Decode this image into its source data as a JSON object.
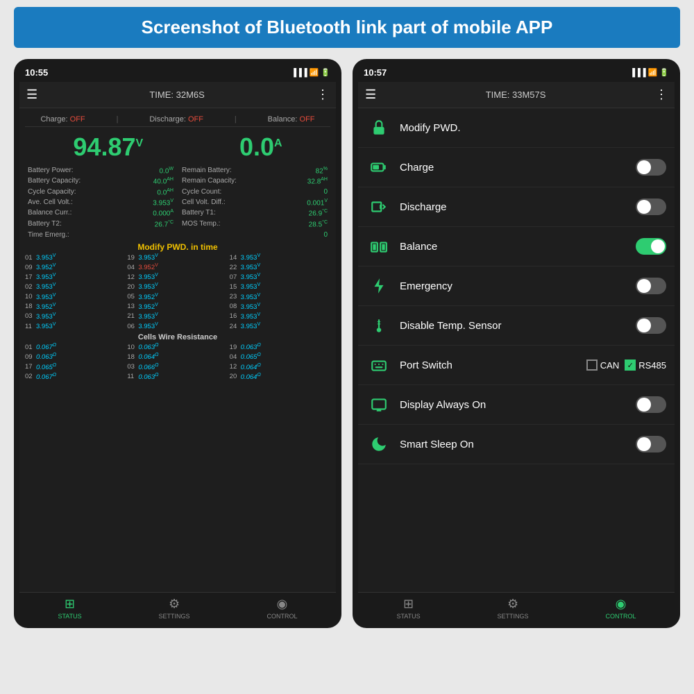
{
  "header": {
    "title": "Screenshot of Bluetooth link part of mobile APP"
  },
  "left_phone": {
    "status_bar": {
      "time": "10:55"
    },
    "app_bar": {
      "time_label": "TIME: 32M6S"
    },
    "charge_row": {
      "charge": "Charge: OFF",
      "discharge": "Discharge: OFF",
      "balance": "Balance: OFF"
    },
    "volt": "94.87",
    "volt_unit": "V",
    "amp": "0.0",
    "amp_unit": "A",
    "stats": [
      {
        "label": "Battery Power:",
        "val": "0.0",
        "unit": "W"
      },
      {
        "label": "Remain Battery:",
        "val": "82",
        "unit": "%"
      },
      {
        "label": "Battery Capacity:",
        "val": "40.0",
        "unit": "AH"
      },
      {
        "label": "Remain Capacity:",
        "val": "32.8",
        "unit": "AH"
      },
      {
        "label": "Cycle Capacity:",
        "val": "0.0",
        "unit": "AH"
      },
      {
        "label": "Cycle Count:",
        "val": "0",
        "unit": ""
      },
      {
        "label": "Ave. Cell Volt.:",
        "val": "3.953",
        "unit": "V"
      },
      {
        "label": "Cell Volt. Diff.:",
        "val": "0.001",
        "unit": "V"
      },
      {
        "label": "Balance Curr.:",
        "val": "0.000",
        "unit": "A"
      },
      {
        "label": "Battery T1:",
        "val": "26.9",
        "unit": "°C"
      },
      {
        "label": "Battery T2:",
        "val": "26.7",
        "unit": "°C"
      },
      {
        "label": "MOS Temp.:",
        "val": "28.5",
        "unit": "°C"
      },
      {
        "label": "Time Emerg.:",
        "val": "0",
        "unit": ""
      }
    ],
    "modify_title": "Modify PWD. in time",
    "cells": [
      {
        "num": "01",
        "val": "3.953",
        "red": false
      },
      {
        "num": "09",
        "val": "3.952",
        "red": false
      },
      {
        "num": "17",
        "val": "3.953",
        "red": false
      },
      {
        "num": "02",
        "val": "3.953",
        "red": false
      },
      {
        "num": "10",
        "val": "3.953",
        "red": false
      },
      {
        "num": "18",
        "val": "3.952",
        "red": false
      },
      {
        "num": "03",
        "val": "3.953",
        "red": false
      },
      {
        "num": "11",
        "val": "3.953",
        "red": false
      },
      {
        "num": "19",
        "val": "3.953",
        "red": false
      },
      {
        "num": "04",
        "val": "3.952",
        "red": true
      },
      {
        "num": "12",
        "val": "3.953",
        "red": false
      },
      {
        "num": "20",
        "val": "3.953",
        "red": false
      },
      {
        "num": "05",
        "val": "3.952",
        "red": false
      },
      {
        "num": "13",
        "val": "3.952",
        "red": false
      },
      {
        "num": "21",
        "val": "3.953",
        "red": false
      },
      {
        "num": "06",
        "val": "3.953",
        "red": false
      },
      {
        "num": "14",
        "val": "3.953",
        "red": false
      },
      {
        "num": "22",
        "val": "3.953",
        "red": false
      },
      {
        "num": "07",
        "val": "3.953",
        "red": false
      },
      {
        "num": "15",
        "val": "3.953",
        "red": false
      },
      {
        "num": "23",
        "val": "3.953",
        "red": false
      },
      {
        "num": "08",
        "val": "3.953",
        "red": false
      },
      {
        "num": "16",
        "val": "3.953",
        "red": false
      },
      {
        "num": "24",
        "val": "3.953",
        "red": false
      }
    ],
    "resistance_title": "Cells Wire Resistance",
    "resistances": [
      {
        "num": "01",
        "val": "0.067"
      },
      {
        "num": "09",
        "val": "0.063"
      },
      {
        "num": "17",
        "val": "0.065"
      },
      {
        "num": "02",
        "val": "0.067"
      },
      {
        "num": "10",
        "val": "0.063"
      },
      {
        "num": "18",
        "val": "0.064"
      },
      {
        "num": "03",
        "val": "0.066"
      },
      {
        "num": "11",
        "val": "0.063"
      },
      {
        "num": "19",
        "val": "0.063"
      },
      {
        "num": "04",
        "val": "0.065"
      },
      {
        "num": "12",
        "val": "0.064"
      },
      {
        "num": "20",
        "val": "0.064"
      }
    ],
    "nav": [
      {
        "label": "STATUS",
        "active": true
      },
      {
        "label": "SETTINGS",
        "active": false
      },
      {
        "label": "CONTROL",
        "active": false
      }
    ]
  },
  "right_phone": {
    "status_bar": {
      "time": "10:57"
    },
    "app_bar": {
      "time_label": "TIME: 33M57S"
    },
    "controls": [
      {
        "label": "Modify PWD.",
        "icon": "🔒",
        "toggle": false,
        "has_toggle": false
      },
      {
        "label": "Charge",
        "icon": "🔋",
        "toggle": false,
        "has_toggle": true
      },
      {
        "label": "Discharge",
        "icon": "♻",
        "toggle": false,
        "has_toggle": true
      },
      {
        "label": "Balance",
        "icon": "🔋",
        "toggle": true,
        "has_toggle": true
      },
      {
        "label": "Emergency",
        "icon": "⚡",
        "toggle": false,
        "has_toggle": true
      },
      {
        "label": "Disable Temp. Sensor",
        "icon": "🌡",
        "toggle": false,
        "has_toggle": true
      },
      {
        "label": "Port Switch",
        "icon": "⌨",
        "toggle": false,
        "has_toggle": false,
        "port_switch": true
      },
      {
        "label": "Display Always On",
        "icon": "📺",
        "toggle": false,
        "has_toggle": true
      },
      {
        "label": "Smart Sleep On",
        "icon": "🌙",
        "toggle": false,
        "has_toggle": true
      }
    ],
    "port_switch": {
      "can_label": "CAN",
      "can_checked": false,
      "rs485_label": "RS485",
      "rs485_checked": true
    },
    "nav": [
      {
        "label": "STATUS",
        "active": false
      },
      {
        "label": "SETTINGS",
        "active": false
      },
      {
        "label": "CONTROL",
        "active": true
      }
    ]
  }
}
